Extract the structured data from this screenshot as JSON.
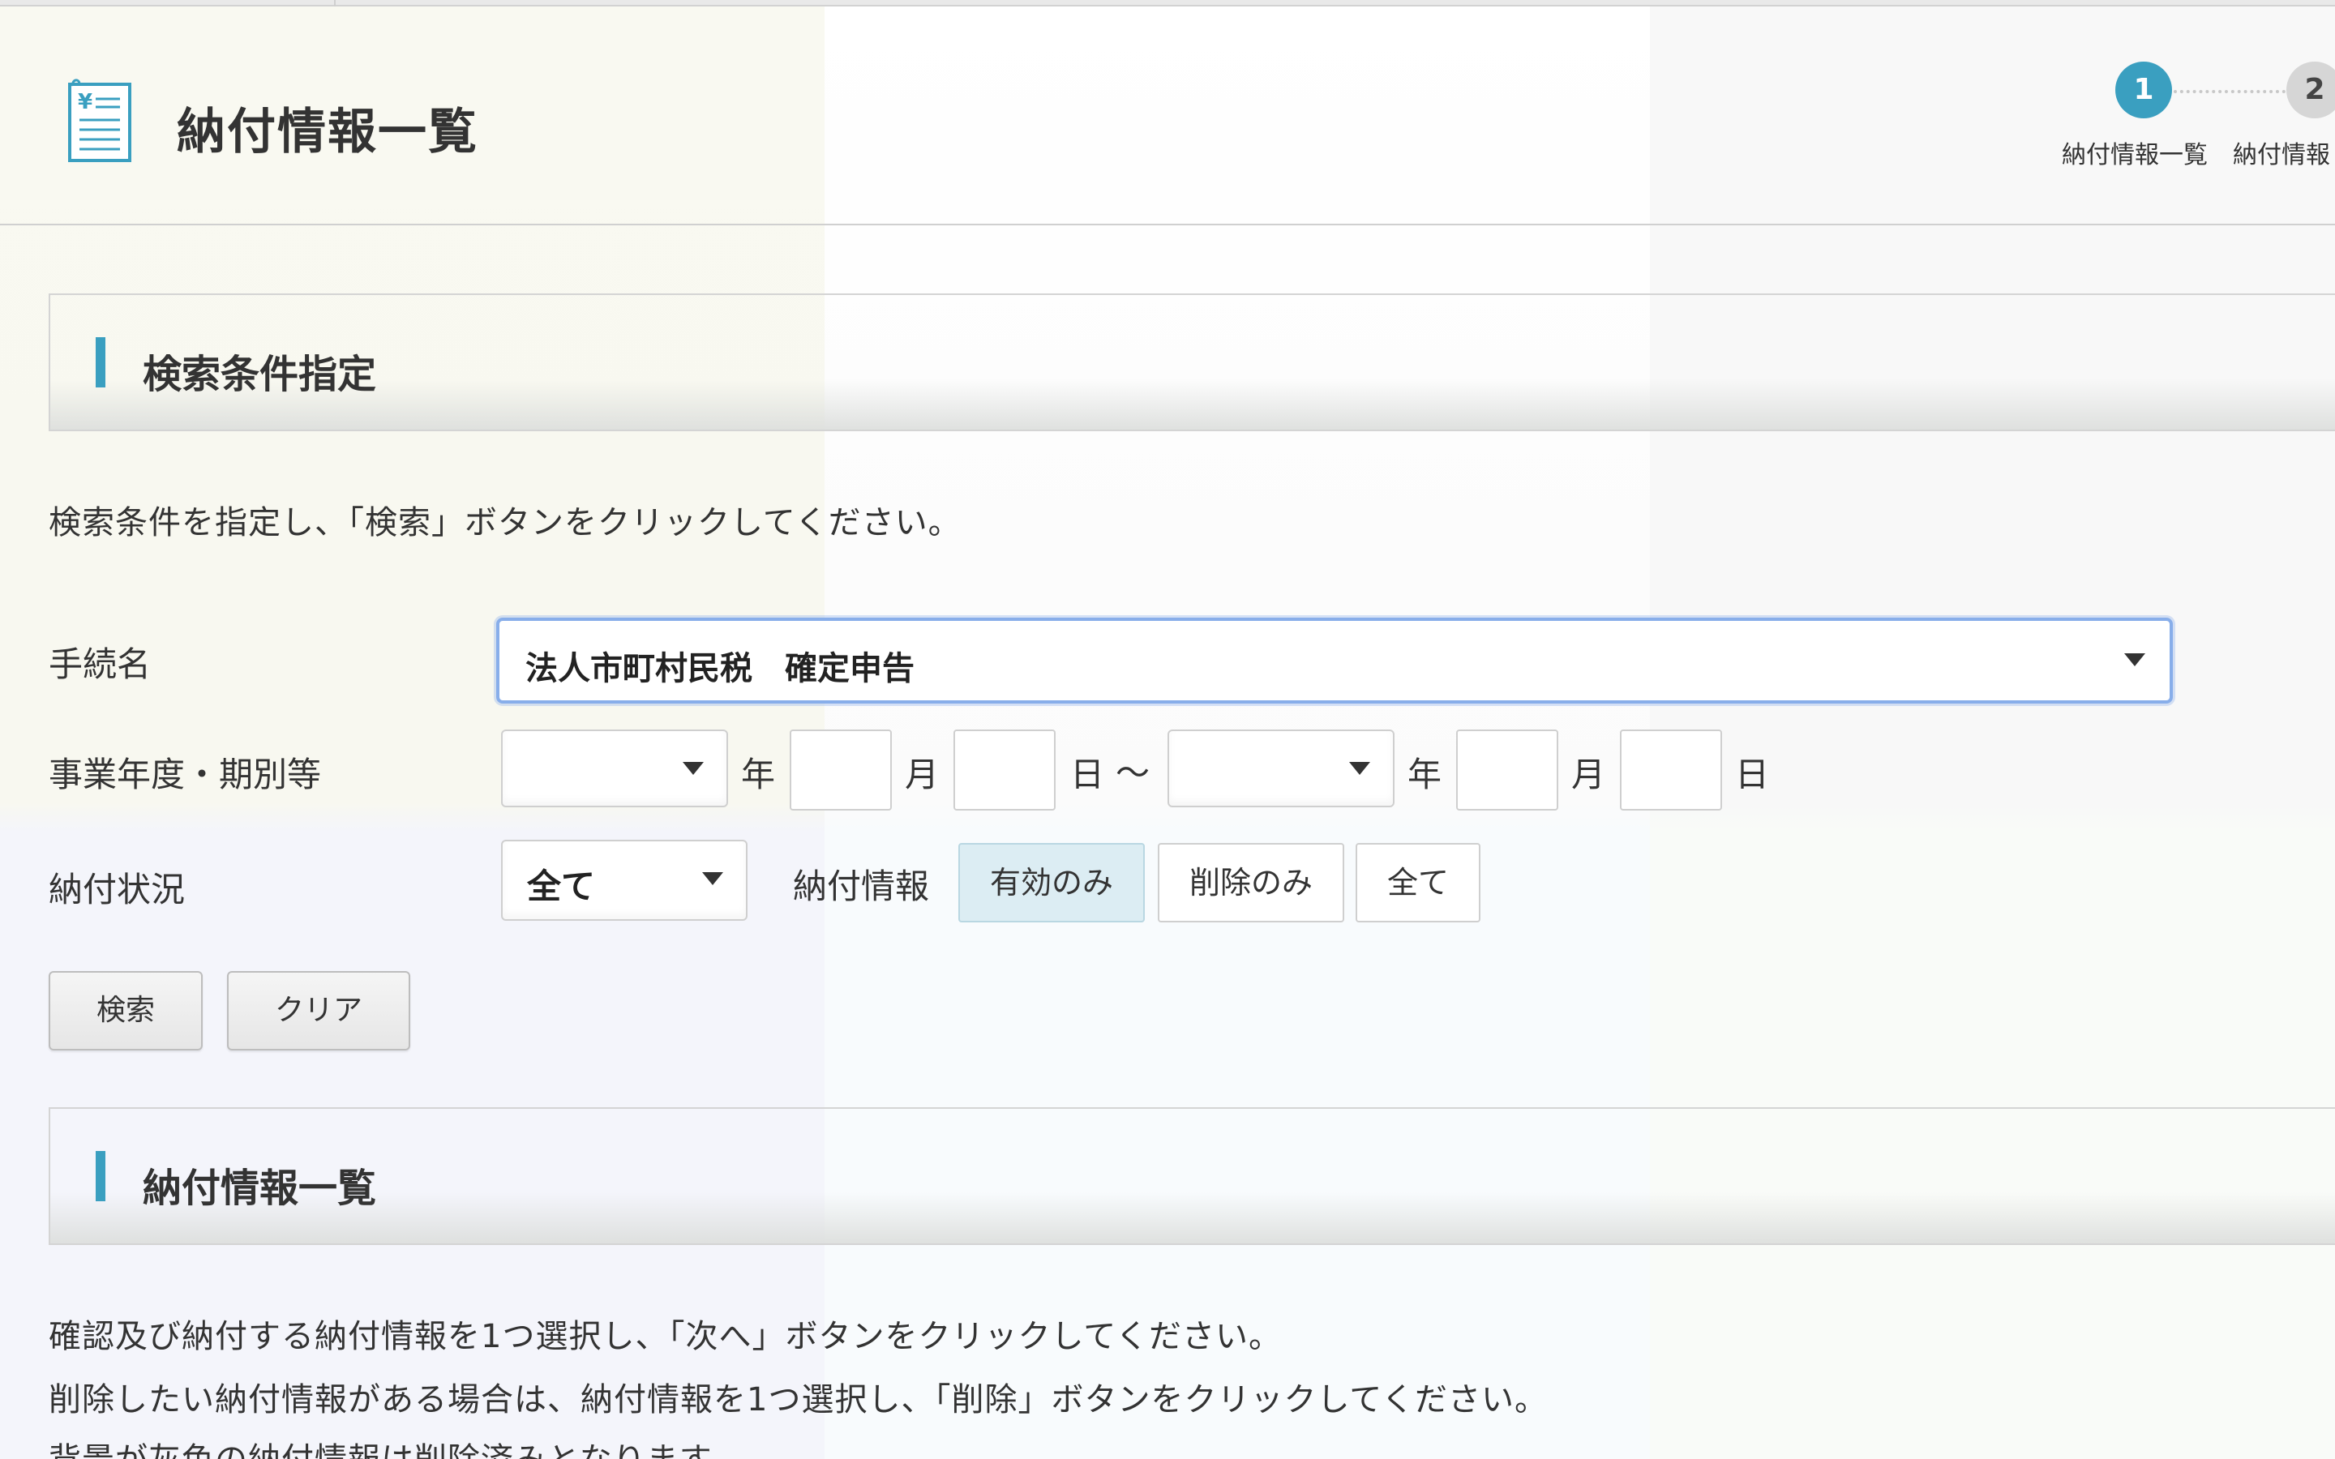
{
  "header": {
    "title": "納付情報一覧"
  },
  "stepper": {
    "steps": [
      {
        "number": "1",
        "label": "納付情報一覧",
        "active": true
      },
      {
        "number": "2",
        "label": "納付情報",
        "active": false
      }
    ]
  },
  "search_section": {
    "title": "検索条件指定",
    "instruction": "検索条件を指定し、「検索」ボタンをクリックしてください。",
    "procedure": {
      "label": "手続名",
      "value": "法人市町村民税　確定申告"
    },
    "period": {
      "label": "事業年度・期別等",
      "from_year": "",
      "from_month": "",
      "from_day": "",
      "to_year": "",
      "to_month": "",
      "to_day": "",
      "year_unit": "年",
      "month_unit": "月",
      "day_unit": "日",
      "range_sep": "〜"
    },
    "payment_status": {
      "label": "納付状況",
      "value": "全て"
    },
    "payment_info": {
      "label": "納付情報",
      "options": [
        "有効のみ",
        "削除のみ",
        "全て"
      ],
      "selected": "有効のみ"
    },
    "buttons": {
      "search": "検索",
      "clear": "クリア"
    }
  },
  "list_section": {
    "title": "納付情報一覧",
    "instructions": [
      "確認及び納付する納付情報を1つ選択し、「次へ」ボタンをクリックしてください。",
      "削除したい納付情報がある場合は、納付情報を1つ選択し、「削除」ボタンをクリックしてください。",
      "背景が灰色の納付情報は削除済みとなります。"
    ]
  },
  "colors": {
    "accent": "#3a9fc0",
    "focus_border": "#88aeea",
    "active_segment": "#dcedf3"
  }
}
